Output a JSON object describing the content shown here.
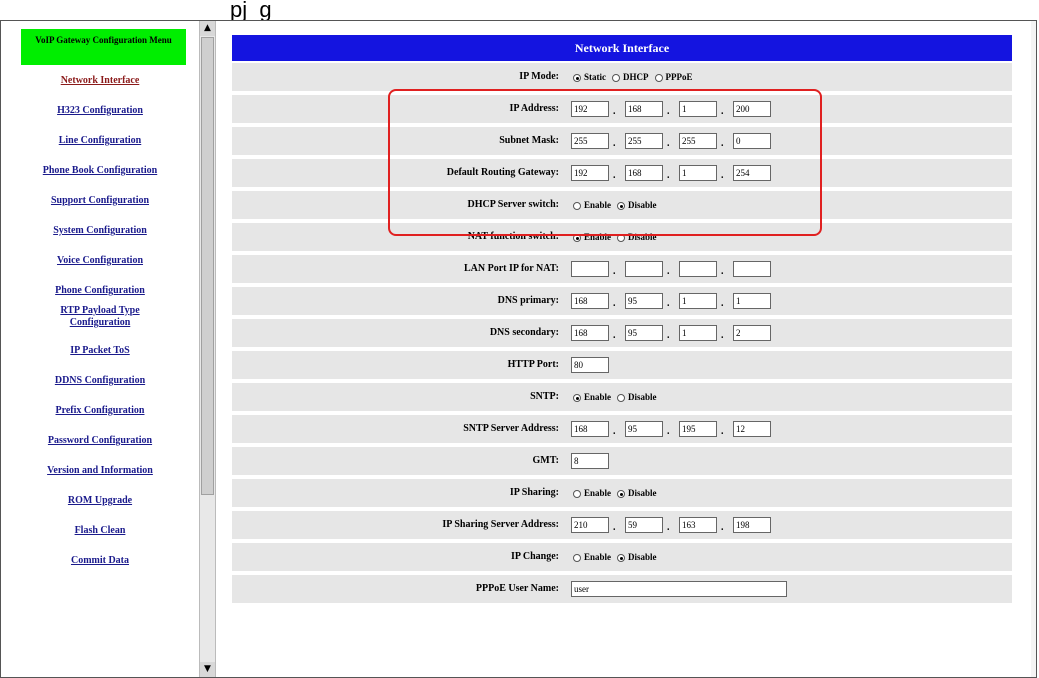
{
  "caption": "pj      g",
  "menu": {
    "header": "VoIP Gateway Configuration Menu",
    "items": [
      {
        "label": "Network Interface",
        "visited": true
      },
      {
        "label": "H323 Configuration",
        "visited": false
      },
      {
        "label": "Line Configuration",
        "visited": false
      },
      {
        "label": "Phone Book Configuration",
        "visited": false
      },
      {
        "label": "Support Configuration",
        "visited": false
      },
      {
        "label": "System Configuration",
        "visited": false
      },
      {
        "label": "Voice Configuration",
        "visited": false
      },
      {
        "label": "Phone Configuration",
        "visited": false
      },
      {
        "label": "RTP Payload Type Configuration",
        "visited": false
      },
      {
        "label": "IP Packet ToS",
        "visited": false
      },
      {
        "label": "DDNS Configuration",
        "visited": false
      },
      {
        "label": "Prefix Configuration",
        "visited": false
      },
      {
        "label": "Password Configuration",
        "visited": false
      },
      {
        "label": "Version and Information",
        "visited": false
      },
      {
        "label": "ROM Upgrade",
        "visited": false
      },
      {
        "label": "Flash Clean",
        "visited": false
      },
      {
        "label": "Commit Data",
        "visited": false
      }
    ]
  },
  "content": {
    "title": "Network Interface",
    "rows": {
      "ip_mode": {
        "label": "IP Mode:",
        "options": [
          "Static",
          "DHCP",
          "PPPoE"
        ],
        "selected": 0
      },
      "ip_address": {
        "label": "IP Address:",
        "octets": [
          "192",
          "168",
          "1",
          "200"
        ]
      },
      "subnet_mask": {
        "label": "Subnet Mask:",
        "octets": [
          "255",
          "255",
          "255",
          "0"
        ]
      },
      "default_gateway": {
        "label": "Default Routing Gateway:",
        "octets": [
          "192",
          "168",
          "1",
          "254"
        ]
      },
      "dhcp_server": {
        "label": "DHCP Server switch:",
        "options": [
          "Enable",
          "Disable"
        ],
        "selected": 1
      },
      "nat_function": {
        "label": "NAT function switch:",
        "options": [
          "Enable",
          "Disable"
        ],
        "selected": 0
      },
      "lan_port_ip": {
        "label": "LAN Port IP for NAT:",
        "octets": [
          "",
          "",
          "",
          ""
        ]
      },
      "dns_primary": {
        "label": "DNS primary:",
        "octets": [
          "168",
          "95",
          "1",
          "1"
        ]
      },
      "dns_secondary": {
        "label": "DNS secondary:",
        "octets": [
          "168",
          "95",
          "1",
          "2"
        ]
      },
      "http_port": {
        "label": "HTTP Port:",
        "value": "80"
      },
      "sntp": {
        "label": "SNTP:",
        "options": [
          "Enable",
          "Disable"
        ],
        "selected": 0
      },
      "sntp_server": {
        "label": "SNTP Server Address:",
        "octets": [
          "168",
          "95",
          "195",
          "12"
        ]
      },
      "gmt": {
        "label": "GMT:",
        "value": "8"
      },
      "ip_sharing": {
        "label": "IP Sharing:",
        "options": [
          "Enable",
          "Disable"
        ],
        "selected": 1
      },
      "ip_sharing_server": {
        "label": "IP Sharing Server Address:",
        "octets": [
          "210",
          "59",
          "163",
          "198"
        ]
      },
      "ip_change": {
        "label": "IP Change:",
        "options": [
          "Enable",
          "Disable"
        ],
        "selected": 1
      },
      "pppoe_user": {
        "label": "PPPoE User Name:",
        "value": "user"
      }
    }
  },
  "colors": {
    "menu_header_bg": "#00ee00",
    "title_bar_bg": "#1414e0",
    "row_bg": "#e6e6e6",
    "highlight_border": "#e02020"
  }
}
